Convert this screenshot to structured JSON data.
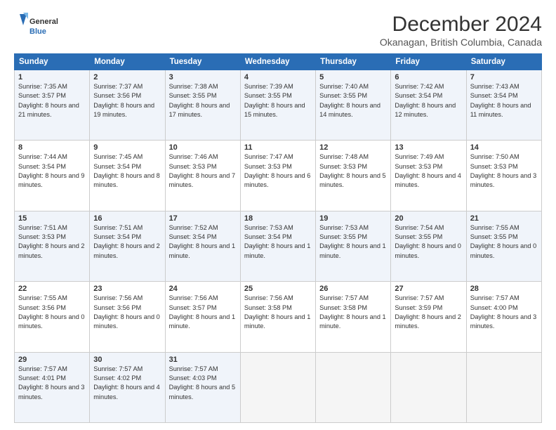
{
  "header": {
    "logo_line1": "General",
    "logo_line2": "Blue",
    "month": "December 2024",
    "location": "Okanagan, British Columbia, Canada"
  },
  "days_of_week": [
    "Sunday",
    "Monday",
    "Tuesday",
    "Wednesday",
    "Thursday",
    "Friday",
    "Saturday"
  ],
  "weeks": [
    [
      {
        "day": 1,
        "sunrise": "Sunrise: 7:35 AM",
        "sunset": "Sunset: 3:57 PM",
        "daylight": "Daylight: 8 hours and 21 minutes."
      },
      {
        "day": 2,
        "sunrise": "Sunrise: 7:37 AM",
        "sunset": "Sunset: 3:56 PM",
        "daylight": "Daylight: 8 hours and 19 minutes."
      },
      {
        "day": 3,
        "sunrise": "Sunrise: 7:38 AM",
        "sunset": "Sunset: 3:55 PM",
        "daylight": "Daylight: 8 hours and 17 minutes."
      },
      {
        "day": 4,
        "sunrise": "Sunrise: 7:39 AM",
        "sunset": "Sunset: 3:55 PM",
        "daylight": "Daylight: 8 hours and 15 minutes."
      },
      {
        "day": 5,
        "sunrise": "Sunrise: 7:40 AM",
        "sunset": "Sunset: 3:55 PM",
        "daylight": "Daylight: 8 hours and 14 minutes."
      },
      {
        "day": 6,
        "sunrise": "Sunrise: 7:42 AM",
        "sunset": "Sunset: 3:54 PM",
        "daylight": "Daylight: 8 hours and 12 minutes."
      },
      {
        "day": 7,
        "sunrise": "Sunrise: 7:43 AM",
        "sunset": "Sunset: 3:54 PM",
        "daylight": "Daylight: 8 hours and 11 minutes."
      }
    ],
    [
      {
        "day": 8,
        "sunrise": "Sunrise: 7:44 AM",
        "sunset": "Sunset: 3:54 PM",
        "daylight": "Daylight: 8 hours and 9 minutes."
      },
      {
        "day": 9,
        "sunrise": "Sunrise: 7:45 AM",
        "sunset": "Sunset: 3:54 PM",
        "daylight": "Daylight: 8 hours and 8 minutes."
      },
      {
        "day": 10,
        "sunrise": "Sunrise: 7:46 AM",
        "sunset": "Sunset: 3:53 PM",
        "daylight": "Daylight: 8 hours and 7 minutes."
      },
      {
        "day": 11,
        "sunrise": "Sunrise: 7:47 AM",
        "sunset": "Sunset: 3:53 PM",
        "daylight": "Daylight: 8 hours and 6 minutes."
      },
      {
        "day": 12,
        "sunrise": "Sunrise: 7:48 AM",
        "sunset": "Sunset: 3:53 PM",
        "daylight": "Daylight: 8 hours and 5 minutes."
      },
      {
        "day": 13,
        "sunrise": "Sunrise: 7:49 AM",
        "sunset": "Sunset: 3:53 PM",
        "daylight": "Daylight: 8 hours and 4 minutes."
      },
      {
        "day": 14,
        "sunrise": "Sunrise: 7:50 AM",
        "sunset": "Sunset: 3:53 PM",
        "daylight": "Daylight: 8 hours and 3 minutes."
      }
    ],
    [
      {
        "day": 15,
        "sunrise": "Sunrise: 7:51 AM",
        "sunset": "Sunset: 3:53 PM",
        "daylight": "Daylight: 8 hours and 2 minutes."
      },
      {
        "day": 16,
        "sunrise": "Sunrise: 7:51 AM",
        "sunset": "Sunset: 3:54 PM",
        "daylight": "Daylight: 8 hours and 2 minutes."
      },
      {
        "day": 17,
        "sunrise": "Sunrise: 7:52 AM",
        "sunset": "Sunset: 3:54 PM",
        "daylight": "Daylight: 8 hours and 1 minute."
      },
      {
        "day": 18,
        "sunrise": "Sunrise: 7:53 AM",
        "sunset": "Sunset: 3:54 PM",
        "daylight": "Daylight: 8 hours and 1 minute."
      },
      {
        "day": 19,
        "sunrise": "Sunrise: 7:53 AM",
        "sunset": "Sunset: 3:55 PM",
        "daylight": "Daylight: 8 hours and 1 minute."
      },
      {
        "day": 20,
        "sunrise": "Sunrise: 7:54 AM",
        "sunset": "Sunset: 3:55 PM",
        "daylight": "Daylight: 8 hours and 0 minutes."
      },
      {
        "day": 21,
        "sunrise": "Sunrise: 7:55 AM",
        "sunset": "Sunset: 3:55 PM",
        "daylight": "Daylight: 8 hours and 0 minutes."
      }
    ],
    [
      {
        "day": 22,
        "sunrise": "Sunrise: 7:55 AM",
        "sunset": "Sunset: 3:56 PM",
        "daylight": "Daylight: 8 hours and 0 minutes."
      },
      {
        "day": 23,
        "sunrise": "Sunrise: 7:56 AM",
        "sunset": "Sunset: 3:56 PM",
        "daylight": "Daylight: 8 hours and 0 minutes."
      },
      {
        "day": 24,
        "sunrise": "Sunrise: 7:56 AM",
        "sunset": "Sunset: 3:57 PM",
        "daylight": "Daylight: 8 hours and 1 minute."
      },
      {
        "day": 25,
        "sunrise": "Sunrise: 7:56 AM",
        "sunset": "Sunset: 3:58 PM",
        "daylight": "Daylight: 8 hours and 1 minute."
      },
      {
        "day": 26,
        "sunrise": "Sunrise: 7:57 AM",
        "sunset": "Sunset: 3:58 PM",
        "daylight": "Daylight: 8 hours and 1 minute."
      },
      {
        "day": 27,
        "sunrise": "Sunrise: 7:57 AM",
        "sunset": "Sunset: 3:59 PM",
        "daylight": "Daylight: 8 hours and 2 minutes."
      },
      {
        "day": 28,
        "sunrise": "Sunrise: 7:57 AM",
        "sunset": "Sunset: 4:00 PM",
        "daylight": "Daylight: 8 hours and 3 minutes."
      }
    ],
    [
      {
        "day": 29,
        "sunrise": "Sunrise: 7:57 AM",
        "sunset": "Sunset: 4:01 PM",
        "daylight": "Daylight: 8 hours and 3 minutes."
      },
      {
        "day": 30,
        "sunrise": "Sunrise: 7:57 AM",
        "sunset": "Sunset: 4:02 PM",
        "daylight": "Daylight: 8 hours and 4 minutes."
      },
      {
        "day": 31,
        "sunrise": "Sunrise: 7:57 AM",
        "sunset": "Sunset: 4:03 PM",
        "daylight": "Daylight: 8 hours and 5 minutes."
      },
      null,
      null,
      null,
      null
    ]
  ]
}
